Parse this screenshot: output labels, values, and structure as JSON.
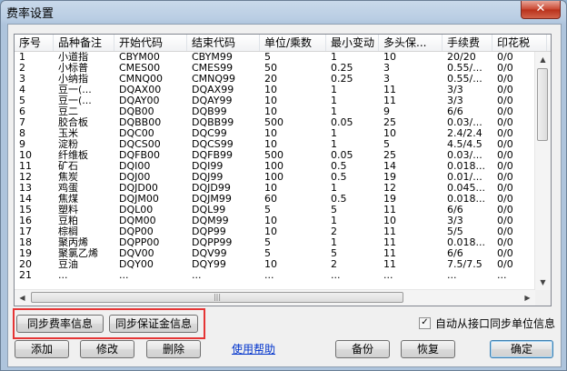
{
  "window": {
    "title": "费率设置",
    "close_label": "✕"
  },
  "table": {
    "columns": [
      "序号",
      "品种备注",
      "开始代码",
      "结束代码",
      "单位/乘数",
      "最小变动",
      "多头保...",
      "手续费",
      "印花税"
    ],
    "rows": [
      [
        "1",
        "小道指",
        "CBYM00",
        "CBYM99",
        "5",
        "1",
        "10",
        "20/20",
        "0/0"
      ],
      [
        "2",
        "小标普",
        "CMES00",
        "CMES99",
        "50",
        "0.25",
        "3",
        "0.55/...",
        "0/0"
      ],
      [
        "3",
        "小纳指",
        "CMNQ00",
        "CMNQ99",
        "20",
        "0.25",
        "3",
        "0.55/...",
        "0/0"
      ],
      [
        "4",
        "豆一(...",
        "DQAX00",
        "DQAX99",
        "10",
        "1",
        "11",
        "3/3",
        "0/0"
      ],
      [
        "5",
        "豆一(...",
        "DQAY00",
        "DQAY99",
        "10",
        "1",
        "11",
        "3/3",
        "0/0"
      ],
      [
        "6",
        "豆二",
        "DQB00",
        "DQB99",
        "10",
        "1",
        "9",
        "6/6",
        "0/0"
      ],
      [
        "7",
        "胶合板",
        "DQBB00",
        "DQBB99",
        "500",
        "0.05",
        "25",
        "0.03/...",
        "0/0"
      ],
      [
        "8",
        "玉米",
        "DQC00",
        "DQC99",
        "10",
        "1",
        "10",
        "2.4/2.4",
        "0/0"
      ],
      [
        "9",
        "淀粉",
        "DQCS00",
        "DQCS99",
        "10",
        "1",
        "5",
        "4.5/4.5",
        "0/0"
      ],
      [
        "10",
        "纤维板",
        "DQFB00",
        "DQFB99",
        "500",
        "0.05",
        "25",
        "0.03/...",
        "0/0"
      ],
      [
        "11",
        "矿石",
        "DQI00",
        "DQI99",
        "100",
        "0.5",
        "14",
        "0.018...",
        "0/0"
      ],
      [
        "12",
        "焦炭",
        "DQJ00",
        "DQJ99",
        "100",
        "0.5",
        "19",
        "0.01/...",
        "0/0"
      ],
      [
        "13",
        "鸡蛋",
        "DQJD00",
        "DQJD99",
        "10",
        "1",
        "12",
        "0.045...",
        "0/0"
      ],
      [
        "14",
        "焦煤",
        "DQJM00",
        "DQJM99",
        "60",
        "0.5",
        "19",
        "0.018...",
        "0/0"
      ],
      [
        "15",
        "塑料",
        "DQL00",
        "DQL99",
        "5",
        "5",
        "11",
        "6/6",
        "0/0"
      ],
      [
        "16",
        "豆粕",
        "DQM00",
        "DQM99",
        "10",
        "1",
        "10",
        "3/3",
        "0/0"
      ],
      [
        "17",
        "棕榈",
        "DQP00",
        "DQP99",
        "10",
        "2",
        "11",
        "5/5",
        "0/0"
      ],
      [
        "18",
        "聚丙烯",
        "DQPP00",
        "DQPP99",
        "5",
        "1",
        "11",
        "0.018...",
        "0/0"
      ],
      [
        "19",
        "聚氯乙烯",
        "DQV00",
        "DQV99",
        "5",
        "5",
        "11",
        "6/6",
        "0/0"
      ],
      [
        "20",
        "豆油",
        "DQY00",
        "DQY99",
        "10",
        "2",
        "11",
        "7.5/7.5",
        "0/0"
      ],
      [
        "21",
        "...",
        "...",
        "...",
        "...",
        "...",
        "...",
        "...",
        "..."
      ]
    ]
  },
  "buttons": {
    "sync_fee": "同步费率信息",
    "sync_margin": "同步保证金信息",
    "add": "添加",
    "modify": "修改",
    "delete": "删除",
    "help": "使用帮助",
    "backup": "备份",
    "restore": "恢复",
    "ok": "确定"
  },
  "checkbox": {
    "label": "自动从接口同步单位信息",
    "checked": true,
    "mark": "✓"
  },
  "colors": {
    "highlight": "#e53535",
    "title_gradient": "#b9cde3",
    "close": "#c8452f"
  }
}
